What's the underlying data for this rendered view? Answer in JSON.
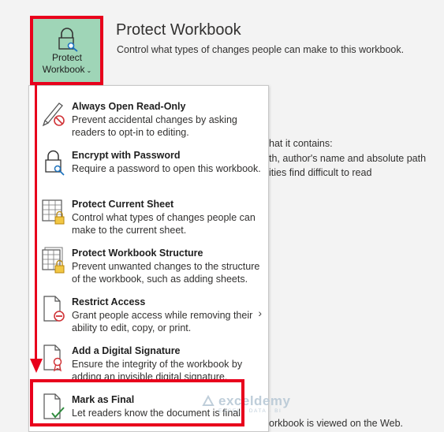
{
  "button": {
    "line1": "Protect",
    "line2": "Workbook",
    "chevron": "⌄",
    "icon": "lock-key-icon"
  },
  "header": {
    "title": "Protect Workbook",
    "description": "Control what types of changes people can make to this workbook."
  },
  "background": {
    "line1": "hat it contains:",
    "line2": "th, author's name and absolute path",
    "line3": "ities find difficult to read",
    "line4": "orkbook is viewed on the Web."
  },
  "menu": {
    "items": [
      {
        "title": "Always Open Read-Only",
        "desc": "Prevent accidental changes by asking readers to opt-in to editing.",
        "icon": "pencil-prohibited-icon"
      },
      {
        "title": "Encrypt with Password",
        "desc": "Require a password to open this workbook.",
        "icon": "lock-key-icon"
      },
      {
        "title": "Protect Current Sheet",
        "desc": "Control what types of changes people can make to the current sheet.",
        "icon": "sheet-lock-icon"
      },
      {
        "title": "Protect Workbook Structure",
        "desc": "Prevent unwanted changes to the structure of the workbook, such as adding sheets.",
        "icon": "workbook-lock-icon"
      },
      {
        "title": "Restrict Access",
        "desc": "Grant people access while removing their ability to edit, copy, or print.",
        "icon": "document-restricted-icon",
        "chevron": "›"
      },
      {
        "title": "Add a Digital Signature",
        "desc": "Ensure the integrity of the workbook by adding an invisible digital signature.",
        "icon": "document-ribbon-icon"
      },
      {
        "title": "Mark as Final",
        "desc": "Let readers know the document is final.",
        "icon": "document-check-icon"
      }
    ]
  },
  "watermark": {
    "name": "exceldemy",
    "tagline": "EXCEL · DATA · BI"
  },
  "colors": {
    "button_bg": "#9fd5b7",
    "highlight": "#e8001c",
    "menu_bg": "#ffffff"
  }
}
